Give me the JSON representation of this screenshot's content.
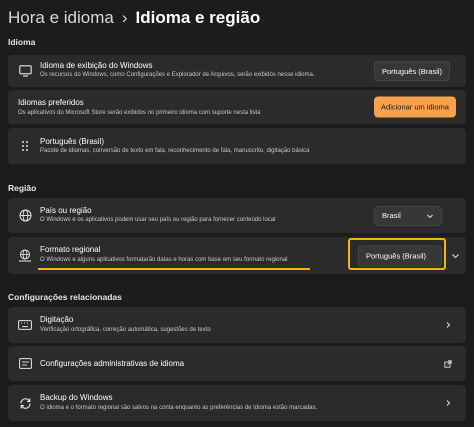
{
  "breadcrumb": {
    "parent": "Hora e idioma",
    "separator": "›",
    "current": "Idioma e região"
  },
  "sections": {
    "idioma": "Idioma",
    "regiao": "Região",
    "configuracoes": "Configurações relacionadas"
  },
  "display_language": {
    "title": "Idioma de exibição do Windows",
    "desc": "Os recursos do Windows, como Configurações e Explorador de Arquivos, serão exibidos nesse idioma.",
    "value": "Português (Brasil)"
  },
  "preferred_languages": {
    "title": "Idiomas preferidos",
    "desc": "Os aplicativos do Microsoft Store serão exibidos no primeiro idioma com suporte nesta lista",
    "button": "Adicionar um idioma"
  },
  "language_pack": {
    "title": "Português (Brasil)",
    "desc": "Pacote de idiomas, conversão de texto em fala, reconhecimento de fala, manuscrito, digitação básica"
  },
  "country": {
    "title": "País ou região",
    "desc": "O Windows e os aplicativos podem usar seu país ou região para fornecer conteúdo local",
    "value": "Brasil"
  },
  "regional_format": {
    "title": "Formato regional",
    "desc": "O Windows e alguns aplicativos formatarão datas e horas com base em seu formato regional",
    "value": "Português (Brasil)"
  },
  "typing": {
    "title": "Digitação",
    "desc": "Verificação ortográfica, correção automática, sugestões de texto"
  },
  "admin_language": {
    "title": "Configurações administrativas de idioma"
  },
  "backup": {
    "title": "Backup do Windows",
    "desc": "O idioma e o formato regional são salvos na conta enquanto as preferências de Idioma estão marcadas."
  },
  "colors": {
    "background": "#1c1c1c",
    "card": "#2b2b2b",
    "accent": "#f9a14a",
    "highlight": "#f5b800"
  }
}
